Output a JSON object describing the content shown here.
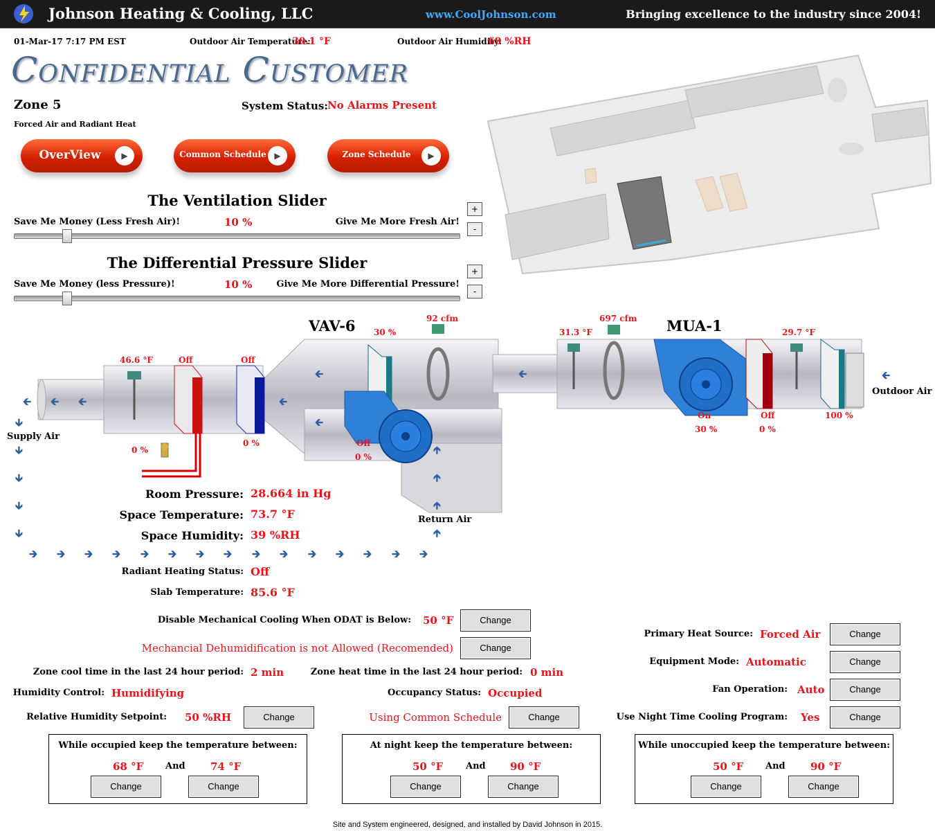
{
  "header": {
    "company": "Johnson Heating & Cooling, LLC",
    "url": "www.CoolJohnson.com",
    "tagline": "Bringing excellence to the industry since 2004!"
  },
  "status_bar": {
    "datetime": "01-Mar-17 7:17 PM EST",
    "oat_label": "Outdoor Air Temperature:",
    "oat_value": "30.1 °F",
    "oah_label": "Outdoor Air Humidity:",
    "oah_value": "69 %RH"
  },
  "customer": "Confidential Customer",
  "zone": {
    "name": "Zone 5",
    "desc": "Forced Air and Radiant Heat",
    "status_label": "System Status:",
    "status_value": "No Alarms Present"
  },
  "nav": {
    "overview": "OverView",
    "common_schedule": "Common Schedule",
    "zone_schedule": "Zone Schedule"
  },
  "vent_slider": {
    "title": "The Ventilation Slider",
    "left": "Save Me Money (Less Fresh Air)!",
    "right": "Give Me More Fresh Air!",
    "value": "10 %",
    "level": 0.1
  },
  "dp_slider": {
    "title": "The Differential Pressure Slider",
    "left": "Save Me Money (less Pressure)!",
    "right": "Give Me More Differential Pressure!",
    "value": "10 %",
    "level": 0.1
  },
  "plus": "+",
  "minus": "-",
  "diagram": {
    "vav_title": "VAV-6",
    "mua_title": "MUA-1",
    "vav_temp": "46.6 °F",
    "heat_coil": "Off",
    "cool_coil": "Off",
    "valve_pct": "0 %",
    "cool_pct": "0 %",
    "damper_pct": "30 %",
    "vav_cfm": "92 cfm",
    "fan_status": "Off",
    "fan_pct": "0 %",
    "mua_temp1": "31.3 °F",
    "mua_cfm": "697 cfm",
    "mua_temp2": "29.7 °F",
    "mua_fan_status": "On",
    "mua_fan_pct": "30 %",
    "mua_coil_status": "Off",
    "mua_coil_pct": "0 %",
    "oa_damper_pct": "100 %",
    "outdoor_air": "Outdoor Air",
    "supply_air": "Supply Air",
    "return_air": "Return Air"
  },
  "space": {
    "room_pressure_label": "Room Pressure:",
    "room_pressure": "28.664 in Hg",
    "space_temp_label": "Space Temperature:",
    "space_temp": "73.7 °F",
    "space_hum_label": "Space Humidity:",
    "space_hum": "39 %RH",
    "radiant_label": "Radiant Heating Status:",
    "radiant": "Off",
    "slab_label": "Slab Temperature:",
    "slab": "85.6 °F"
  },
  "controls": {
    "disable_cooling_label": "Disable Mechanical Cooling When ODAT is Below:",
    "disable_cooling_value": "50 °F",
    "dehum_msg": "Mechancial Dehumidification is not Allowed (Recomended)",
    "zone_cool_label": "Zone cool time in the last 24 hour period:",
    "zone_cool": "2 min",
    "zone_heat_label": "Zone heat time in the last 24 hour period:",
    "zone_heat": "0 min",
    "humidity_control_label": "Humidity Control:",
    "humidity_control": "Humidifying",
    "occupancy_label": "Occupancy Status:",
    "occupancy": "Occupied",
    "rh_setpoint_label": "Relative Humidity Setpoint:",
    "rh_setpoint": "50 %RH",
    "schedule_msg": "Using Common Schedule",
    "primary_heat_label": "Primary Heat Source:",
    "primary_heat": "Forced Air",
    "equip_mode_label": "Equipment Mode:",
    "equip_mode": "Automatic",
    "fan_op_label": "Fan Operation:",
    "fan_op": "Auto",
    "night_cool_label": "Use Night Time Cooling Program:",
    "night_cool": "Yes",
    "change": "Change"
  },
  "ranges": [
    {
      "title": "While occupied keep the temperature between:",
      "low": "68 °F",
      "high": "74 °F",
      "and": "And"
    },
    {
      "title": "At night keep the temperature between:",
      "low": "50 °F",
      "high": "90 °F",
      "and": "And"
    },
    {
      "title": "While unoccupied keep the temperature between:",
      "low": "50 °F",
      "high": "90 °F",
      "and": "And"
    }
  ],
  "footer": "Site and System engineered, designed, and installed by David Johnson in 2015."
}
